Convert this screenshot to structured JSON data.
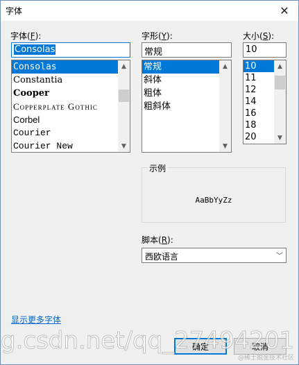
{
  "dialog": {
    "title": "字体",
    "close_glyph": "✕"
  },
  "font": {
    "label_text": "字体(",
    "label_key": "F",
    "label_tail": "):",
    "value": "Consolas",
    "items": [
      "Consolas",
      "Constantia",
      "Cooper",
      "Copperplate Gothic",
      "Corbel",
      "Courier",
      "Courier New"
    ],
    "selected_index": 0
  },
  "style": {
    "label_text": "字形(",
    "label_key": "Y",
    "label_tail": "):",
    "value": "常规",
    "items": [
      "常规",
      "斜体",
      "粗体",
      "粗斜体"
    ],
    "selected_index": 0
  },
  "size": {
    "label_text": "大小(",
    "label_key": "S",
    "label_tail": "):",
    "value": "10",
    "items": [
      "10",
      "11",
      "12",
      "14",
      "16",
      "18",
      "20"
    ],
    "selected_index": 0
  },
  "sample": {
    "label": "示例",
    "text": "AaBbYyZz"
  },
  "script": {
    "label_text": "脚本(",
    "label_key": "R",
    "label_tail": "):",
    "value": "西欧语言"
  },
  "more_fonts_link": "显示更多字体",
  "buttons": {
    "ok": "确定",
    "cancel": "取消"
  },
  "watermark": "g.csdn.net/qq_27494201",
  "corner_watermark": "@稀土掘金技术社区"
}
